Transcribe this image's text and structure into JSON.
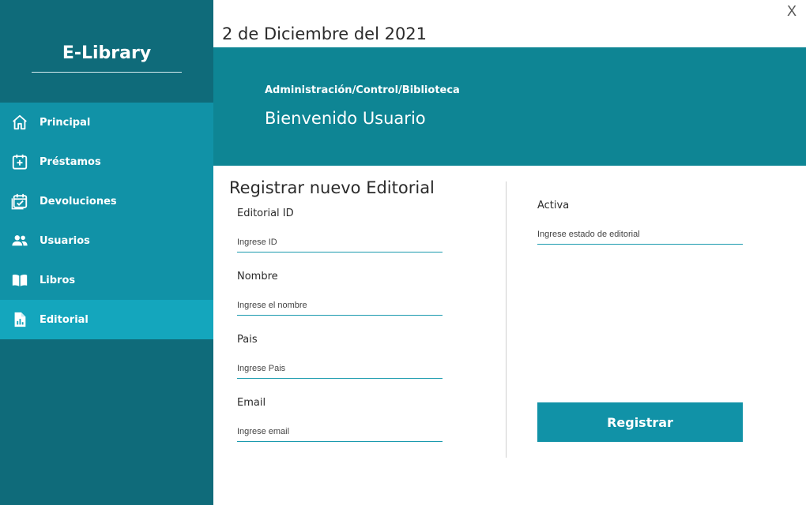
{
  "app": {
    "brand": "E-Library",
    "close_label": "X"
  },
  "header": {
    "date": "2 de Diciembre del 2021",
    "breadcrumb": "Administración/Control/Biblioteca",
    "welcome": "Bienvenido Usuario"
  },
  "sidebar": {
    "items": [
      {
        "label": "Principal",
        "icon": "home-icon"
      },
      {
        "label": "Préstamos",
        "icon": "calendar-plus-icon"
      },
      {
        "label": "Devoluciones",
        "icon": "calendar-check-icon"
      },
      {
        "label": "Usuarios",
        "icon": "users-icon"
      },
      {
        "label": "Libros",
        "icon": "book-icon"
      },
      {
        "label": "Editorial",
        "icon": "file-chart-icon",
        "active": true
      }
    ]
  },
  "form": {
    "title": "Registrar nuevo Editorial",
    "fields": {
      "id": {
        "label": "Editorial ID",
        "placeholder": "Ingrese ID"
      },
      "name": {
        "label": "Nombre",
        "placeholder": "Ingrese el nombre"
      },
      "country": {
        "label": "Pais",
        "placeholder": "Ingrese Pais"
      },
      "email": {
        "label": "Email",
        "placeholder": "Ingrese email"
      },
      "active": {
        "label": "Activa",
        "placeholder": "Ingrese estado de editorial"
      }
    },
    "submit_label": "Registrar"
  },
  "colors": {
    "sidebar": "#0f6b7a",
    "nav": "#1192a7",
    "nav_active": "#14a6bd",
    "banner": "#0e8594",
    "button": "#1192a7"
  }
}
